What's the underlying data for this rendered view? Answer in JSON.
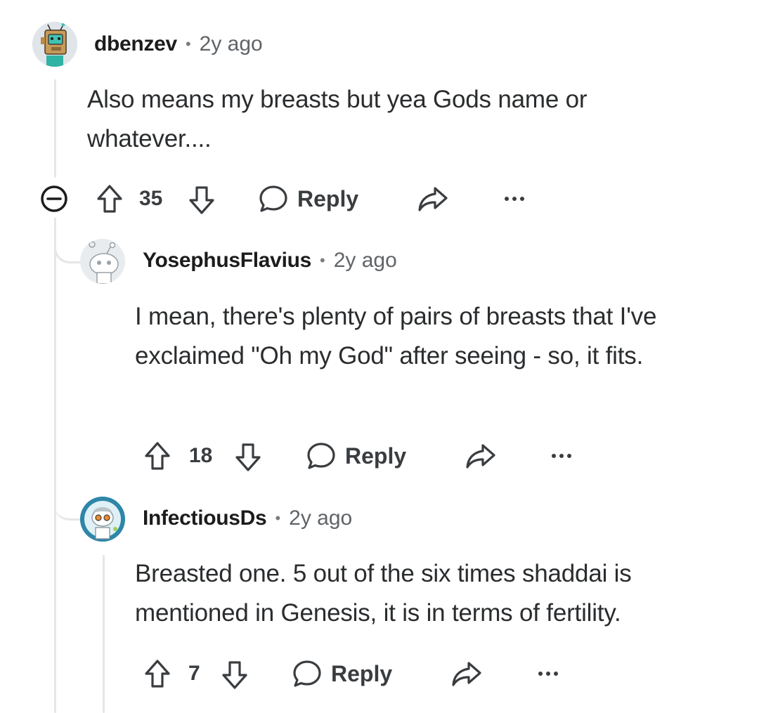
{
  "comments": [
    {
      "username": "dbenzev",
      "age": "2y ago",
      "body": "Also means my breasts but yea Gods name or whatever....",
      "votes": "35",
      "reply_label": "Reply",
      "avatar_icon": "robot-avatar-icon"
    },
    {
      "username": "YosephusFlavius",
      "age": "2y ago",
      "body": "I mean, there's plenty of pairs of breasts that I've exclaimed \"Oh my God\" after seeing - so, it fits.",
      "votes": "18",
      "reply_label": "Reply",
      "avatar_icon": "snoo-avatar-icon"
    },
    {
      "username": "InfectiousDs",
      "age": "2y ago",
      "body": "Breasted one. 5 out of the six times shaddai is mentioned in Genesis, it is in terms of fertility.",
      "votes": "7",
      "reply_label": "Reply",
      "avatar_icon": "scientist-avatar-icon"
    }
  ],
  "separator": "•",
  "colors": {
    "text": "#1c1c1c",
    "muted": "#5f6468",
    "thread": "#e4e6e8",
    "icon": "#3a3d40"
  }
}
